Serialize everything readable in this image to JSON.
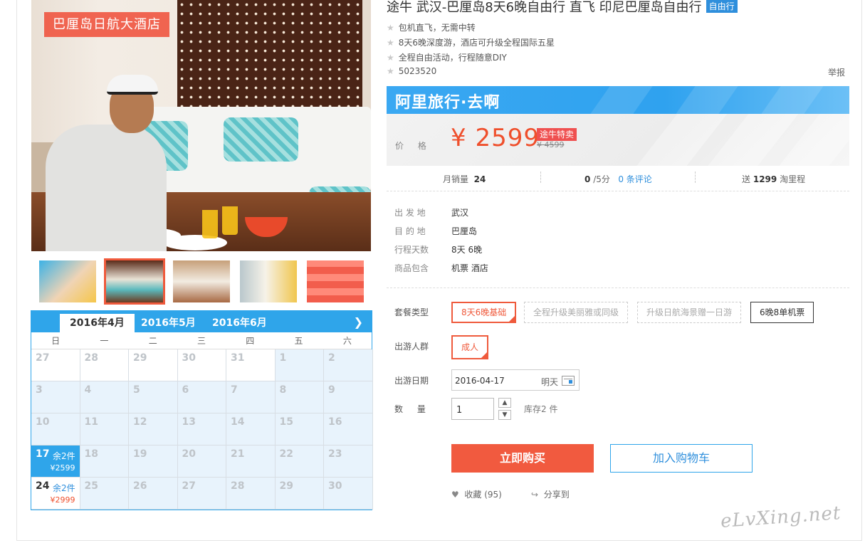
{
  "hero": {
    "badge": "巴厘岛日航大酒店"
  },
  "calendar": {
    "months": [
      "2016年4月",
      "2016年5月",
      "2016年6月"
    ],
    "weekdays": [
      "日",
      "一",
      "二",
      "三",
      "四",
      "五",
      "六"
    ],
    "rows": [
      [
        {
          "d": "27",
          "t": "white"
        },
        {
          "d": "28",
          "t": "white"
        },
        {
          "d": "29",
          "t": "white"
        },
        {
          "d": "30",
          "t": "white"
        },
        {
          "d": "31",
          "t": "white"
        },
        {
          "d": "1",
          "t": "blue"
        },
        {
          "d": "2",
          "t": "blue"
        }
      ],
      [
        {
          "d": "3",
          "t": "blue"
        },
        {
          "d": "4",
          "t": "blue"
        },
        {
          "d": "5",
          "t": "blue"
        },
        {
          "d": "6",
          "t": "blue"
        },
        {
          "d": "7",
          "t": "blue"
        },
        {
          "d": "8",
          "t": "blue"
        },
        {
          "d": "9",
          "t": "blue"
        }
      ],
      [
        {
          "d": "10",
          "t": "blue"
        },
        {
          "d": "11",
          "t": "blue"
        },
        {
          "d": "12",
          "t": "blue"
        },
        {
          "d": "13",
          "t": "blue"
        },
        {
          "d": "14",
          "t": "blue"
        },
        {
          "d": "15",
          "t": "blue"
        },
        {
          "d": "16",
          "t": "blue"
        }
      ],
      [
        {
          "d": "17",
          "t": "sel",
          "left": "余2件",
          "price": "¥2599"
        },
        {
          "d": "18",
          "t": "blue"
        },
        {
          "d": "19",
          "t": "blue"
        },
        {
          "d": "20",
          "t": "blue"
        },
        {
          "d": "21",
          "t": "blue"
        },
        {
          "d": "22",
          "t": "blue"
        },
        {
          "d": "23",
          "t": "blue"
        }
      ],
      [
        {
          "d": "24",
          "t": "avail",
          "left": "余2件",
          "price": "¥2999"
        },
        {
          "d": "25",
          "t": "blue"
        },
        {
          "d": "26",
          "t": "blue"
        },
        {
          "d": "27",
          "t": "blue"
        },
        {
          "d": "28",
          "t": "blue"
        },
        {
          "d": "29",
          "t": "blue"
        },
        {
          "d": "30",
          "t": "blue"
        }
      ]
    ]
  },
  "product": {
    "title": "途牛 武汉-巴厘岛8天6晚自由行 直飞 印尼巴厘岛自由行",
    "tag": "自由行",
    "features": [
      "包机直飞，无需中转",
      "8天6晚深度游，酒店可升级全程国际五星",
      "全程自由活动，行程随意DIY",
      "5023520"
    ],
    "report": "举报"
  },
  "banner": {
    "text": "阿里旅行·去啊"
  },
  "price": {
    "label": "价 格",
    "value": "¥ 2599",
    "special": "途牛特卖",
    "original": "¥ 4599"
  },
  "stats": {
    "sales_label": "月销量",
    "sales": "24",
    "score": "0",
    "score_suffix": "/5分",
    "reviews": "0 条评论",
    "gift_prefix": "送",
    "gift_amount": "1299",
    "gift_suffix": "淘里程"
  },
  "info": [
    {
      "k": "出 发 地",
      "v": "武汉"
    },
    {
      "k": "目 的 地",
      "v": "巴厘岛"
    },
    {
      "k": "行程天数",
      "v": "8天 6晚"
    },
    {
      "k": "商品包含",
      "v": "机票  酒店"
    }
  ],
  "options": {
    "package_label": "套餐类型",
    "packages": [
      "8天6晚基础",
      "全程升级美丽雅或同级",
      "升级日航海景赠一日游",
      "6晚8单机票"
    ],
    "people_label": "出游人群",
    "people": "成人",
    "date_label": "出游日期",
    "date_value": "2016-04-17",
    "date_hint": "明天",
    "qty_label": "数 量",
    "qty_value": "1",
    "stock": "库存2 件"
  },
  "actions": {
    "buy": "立即购买",
    "cart": "加入购物车",
    "fav": "收藏 (95)",
    "share": "分享到"
  },
  "watermark": "eLvXing.net",
  "colors": {
    "accent": "#2fa5ea",
    "price": "#ef4f2c",
    "buy": "#f15a3f"
  }
}
